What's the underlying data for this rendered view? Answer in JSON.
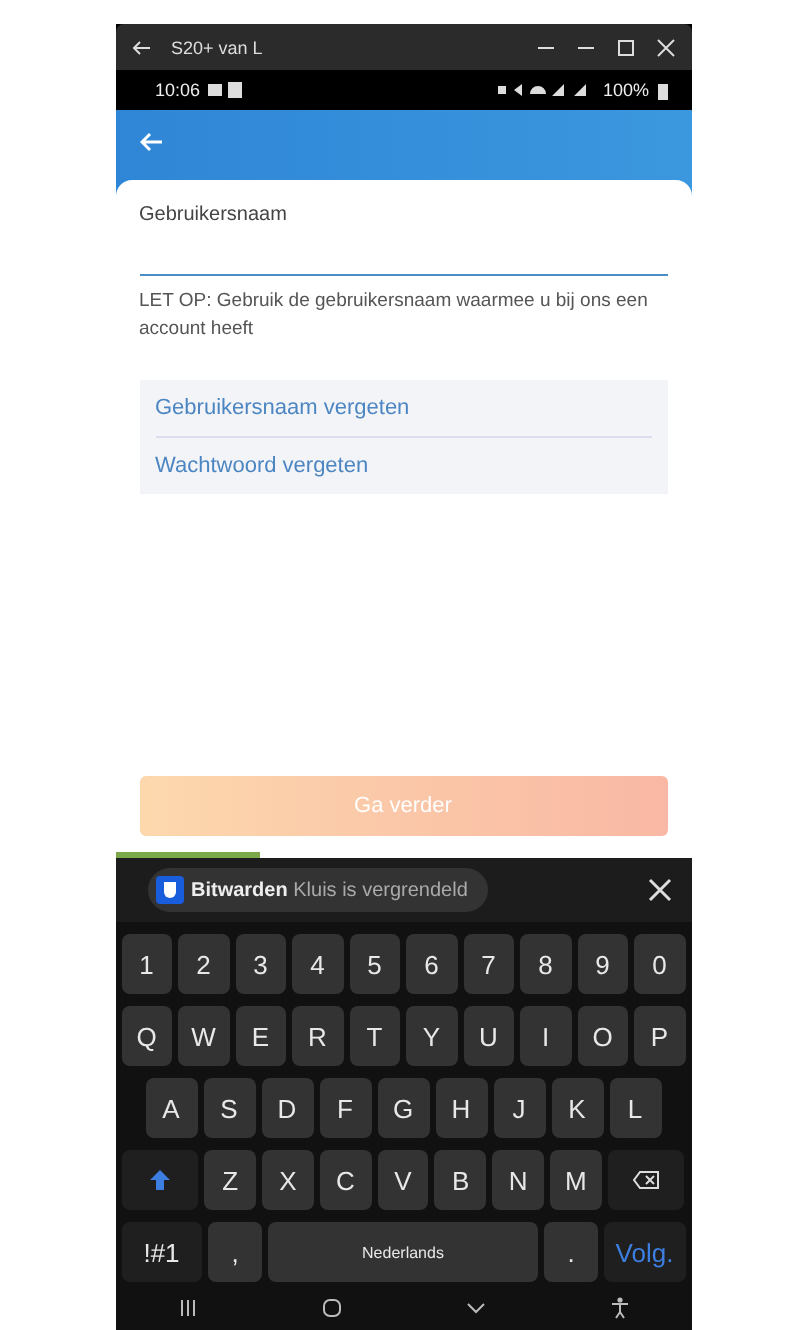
{
  "window": {
    "title": "S20+ van L"
  },
  "status_bar": {
    "time": "10:06",
    "battery": "100%"
  },
  "form": {
    "label": "Gebruikersnaam",
    "note": "LET OP: Gebruik de gebruikersnaam waarmee u bij ons een account heeft",
    "links": [
      "Gebruikersnaam vergeten",
      "Wachtwoord vergeten"
    ],
    "button": {
      "label": "Ga verder",
      "disabled": true
    }
  },
  "progress": {
    "level": 0.25
  },
  "autofill": {
    "app": "Bitwarden",
    "message": "Kluis is vergrendeld"
  },
  "keyboard": {
    "rows": [
      {
        "keys": [
          {
            "kind": "key",
            "label": "1"
          },
          {
            "kind": "key",
            "label": "2"
          },
          {
            "kind": "key",
            "label": "3"
          },
          {
            "kind": "key",
            "label": "4"
          },
          {
            "kind": "key",
            "label": "5"
          },
          {
            "kind": "key",
            "label": "6"
          },
          {
            "kind": "key",
            "label": "7"
          },
          {
            "kind": "key",
            "label": "8"
          },
          {
            "kind": "key",
            "label": "9"
          },
          {
            "kind": "key",
            "label": "0"
          }
        ]
      },
      {
        "keys": [
          {
            "kind": "key",
            "label": "Q"
          },
          {
            "kind": "key",
            "label": "W"
          },
          {
            "kind": "key",
            "label": "E"
          },
          {
            "kind": "key",
            "label": "R"
          },
          {
            "kind": "key",
            "label": "T"
          },
          {
            "kind": "key",
            "label": "Y"
          },
          {
            "kind": "key",
            "label": "U"
          },
          {
            "kind": "key",
            "label": "I"
          },
          {
            "kind": "key",
            "label": "O"
          },
          {
            "kind": "key",
            "label": "P"
          }
        ]
      },
      {
        "keys": [
          {
            "kind": "key",
            "label": "A"
          },
          {
            "kind": "key",
            "label": "S"
          },
          {
            "kind": "key",
            "label": "D"
          },
          {
            "kind": "key",
            "label": "F"
          },
          {
            "kind": "key",
            "label": "G"
          },
          {
            "kind": "key",
            "label": "H"
          },
          {
            "kind": "key",
            "label": "J"
          },
          {
            "kind": "key",
            "label": "K"
          },
          {
            "kind": "key",
            "label": "L"
          }
        ]
      },
      {
        "keys": [
          {
            "kind": "shift"
          },
          {
            "kind": "key",
            "label": "Z"
          },
          {
            "kind": "key",
            "label": "X"
          },
          {
            "kind": "key",
            "label": "C"
          },
          {
            "kind": "key",
            "label": "V"
          },
          {
            "kind": "key",
            "label": "B"
          },
          {
            "kind": "key",
            "label": "N"
          },
          {
            "kind": "key",
            "label": "M"
          },
          {
            "kind": "backspace"
          }
        ]
      },
      {
        "keys": [
          {
            "kind": "symbols",
            "label": "!#1"
          },
          {
            "kind": "key",
            "label": ","
          },
          {
            "kind": "space",
            "label": "Nederlands"
          },
          {
            "kind": "key",
            "label": "."
          },
          {
            "kind": "action",
            "label": "Volg."
          }
        ]
      }
    ]
  }
}
